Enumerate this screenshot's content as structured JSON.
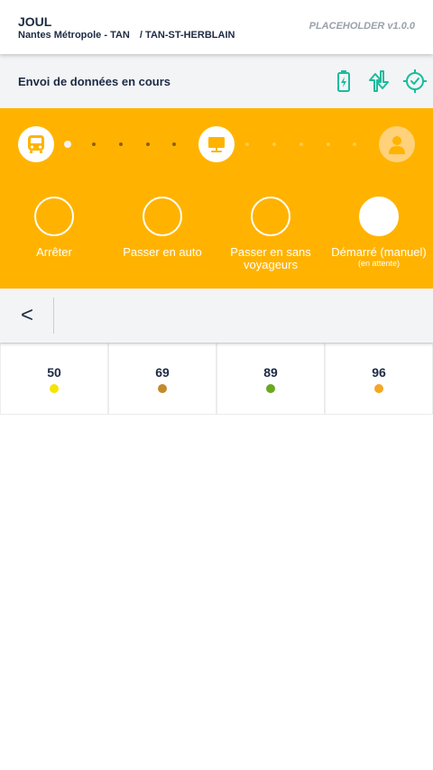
{
  "header": {
    "app_title": "JOUL",
    "network": "Nantes Métropole - TAN",
    "separator": "/",
    "site": "TAN-ST-HERBLAIN",
    "version": "PLACEHOLDER v1.0.0"
  },
  "status": {
    "text": "Envoi de données en cours",
    "icons": [
      "battery-charging-icon",
      "data-transfer-icon",
      "gps-target-icon"
    ],
    "icon_color": "#1abc9c"
  },
  "progress": {
    "steps": [
      "bus-icon",
      "terminal-icon",
      "user-avatar-icon"
    ],
    "accent": "#ffb300"
  },
  "actions": [
    {
      "label": "Arrêter",
      "sub": "",
      "active": false
    },
    {
      "label": "Passer en auto",
      "sub": "",
      "active": false
    },
    {
      "label": "Passer en sans voyageurs",
      "sub": "",
      "active": false
    },
    {
      "label": "Démarré (manuel)",
      "sub": "(en attente)",
      "active": true
    }
  ],
  "nav": {
    "back_label": "<"
  },
  "lines": [
    {
      "number": "50",
      "color": "#f5e400"
    },
    {
      "number": "69",
      "color": "#c48a2c"
    },
    {
      "number": "89",
      "color": "#6aa820"
    },
    {
      "number": "96",
      "color": "#f5a623"
    }
  ]
}
